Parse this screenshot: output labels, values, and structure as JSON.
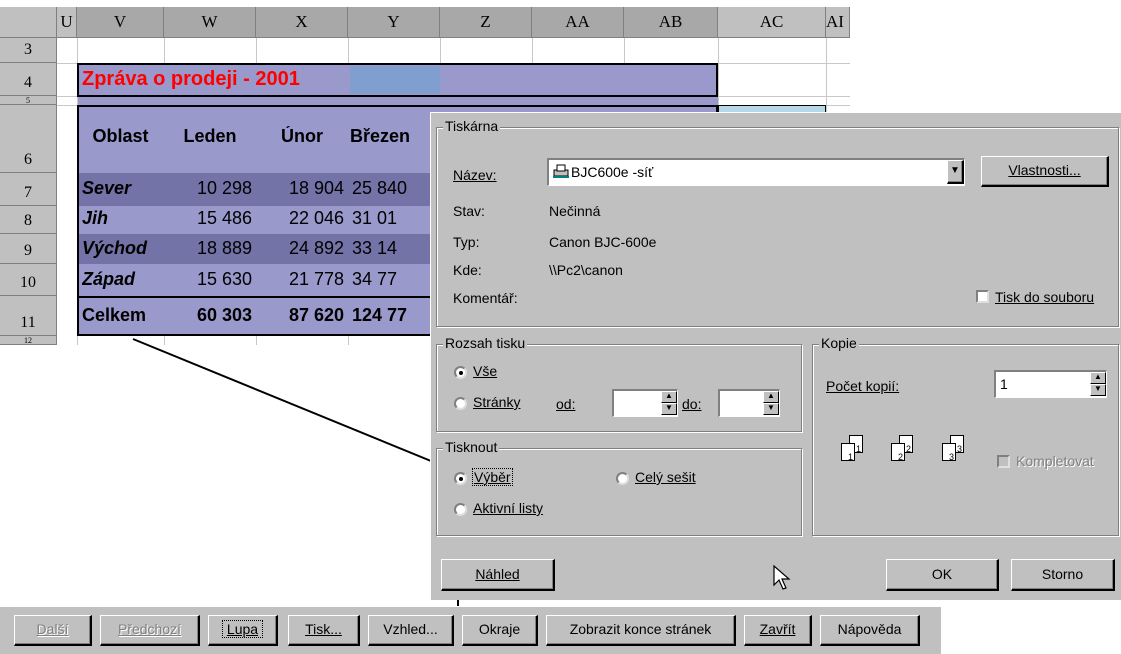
{
  "sheet": {
    "columns": [
      "U",
      "V",
      "W",
      "X",
      "Y",
      "Z",
      "AA",
      "AB",
      "AC",
      "AI"
    ],
    "rows": [
      "3",
      "4",
      "5",
      "6",
      "7",
      "8",
      "9",
      "10",
      "11",
      "12"
    ],
    "title": "Zpráva o prodeji - 2001",
    "headers": [
      "Oblast",
      "Leden",
      "Únor",
      "Březen"
    ],
    "data_rows": [
      {
        "label": "Sever",
        "values": [
          "10 298",
          "18 904",
          "25 840"
        ]
      },
      {
        "label": "Jih",
        "values": [
          "15 486",
          "22 046",
          "31 01"
        ]
      },
      {
        "label": "Východ",
        "values": [
          "18 889",
          "24 892",
          "33 14"
        ]
      },
      {
        "label": "Západ",
        "values": [
          "15 630",
          "21 778",
          "34 77"
        ]
      }
    ],
    "total": {
      "label": "Celkem",
      "values": [
        "60 303",
        "87 620",
        "124 77"
      ]
    },
    "title_color": "#ff0000",
    "selection_color": "#9999cc"
  },
  "dialog": {
    "printer_group": "Tiskárna",
    "name_label": "Název:",
    "name_value": "BJC600e -síť",
    "properties_button": "Vlastnosti...",
    "status_label": "Stav:",
    "status_value": "Nečinná",
    "type_label": "Typ:",
    "type_value": "Canon  BJC-600e",
    "where_label": "Kde:",
    "where_value": "\\\\Pc2\\canon",
    "comment_label": "Komentář:",
    "print_to_file": "Tisk do souboru",
    "range_group": "Rozsah tisku",
    "range_all": "Vše",
    "range_pages": "Stránky",
    "from_label": "od:",
    "to_label": "do:",
    "print_group": "Tisknout",
    "print_selection": "Výběr",
    "print_workbook": "Celý sešit",
    "print_active": "Aktivní listy",
    "copies_group": "Kopie",
    "copies_label": "Počet kopií:",
    "copies_value": "1",
    "collate": "Kompletovat",
    "preview_button": "Náhled",
    "ok_button": "OK",
    "cancel_button": "Storno"
  },
  "toolbar": {
    "next": "Další",
    "prev": "Předchozí",
    "zoom": "Lupa",
    "print": "Tisk...",
    "setup": "Vzhled...",
    "margins": "Okraje",
    "page_breaks": "Zobrazit konce stránek",
    "close": "Zavřít",
    "help": "Nápověda"
  }
}
